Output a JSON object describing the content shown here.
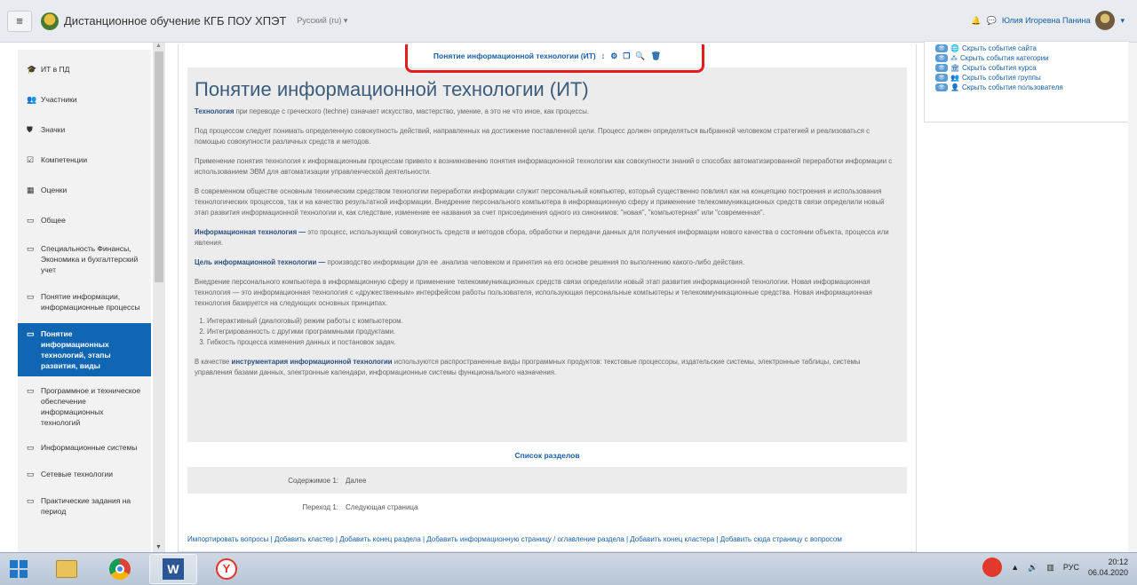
{
  "navbar": {
    "site_name": "Дистанционное обучение КГБ ПОУ ХПЭТ",
    "language": "Русский (ru) ▾",
    "user_name": "Юлия Игоревна Панина"
  },
  "sidebar": {
    "items": [
      {
        "icon": "mortarboard-icon",
        "label": "ИТ в ПД"
      },
      {
        "icon": "users-icon",
        "label": "Участники"
      },
      {
        "icon": "shield-icon",
        "label": "Значки"
      },
      {
        "icon": "checkbox-icon",
        "label": "Компетенции"
      },
      {
        "icon": "table-icon",
        "label": "Оценки"
      },
      {
        "icon": "folder-icon",
        "label": "Общее"
      },
      {
        "icon": "folder-icon",
        "label": "Специальность Финансы, Экономика и бухгалтерский учет"
      },
      {
        "icon": "folder-icon",
        "label": "Понятие информации, информационные процессы"
      },
      {
        "icon": "folder-icon",
        "label": "Понятие информационных технологий, этапы развития, виды"
      },
      {
        "icon": "folder-icon",
        "label": "Программное и техническое обеспечение информационных технологий"
      },
      {
        "icon": "folder-icon",
        "label": "Информационные системы"
      },
      {
        "icon": "folder-icon",
        "label": "Сетевые технологии"
      },
      {
        "icon": "folder-icon",
        "label": "Практические задания на период"
      }
    ]
  },
  "lesson": {
    "header_title": "Понятие информационной технологии (ИТ)",
    "page_title": "Понятие информационной технологии (ИТ)",
    "p1_bold": "Технология",
    "p1_rest": " при переводе с греческого (techne) означает искусство, мастерство, умение, а это не что иное, как процессы.",
    "p2": "Под процессом следует понимать определенную совокупность действий, направленных на достижение поставленной цели. Процесс должен определяться выбранной человеком стратегией и реализоваться с помощью совокупности различных средств и методов.",
    "p3": "Применение понятия технология к информационным процессам привело к возникновению понятия информационной технологии как совокупности знаний о способах автоматизированной переработки информации с использованием ЭВМ для автоматизации управленческой деятельности.",
    "p4": "В современном обществе основным техническим средством технологии переработки информации служит персональный компьютер, который существенно повлиял как на концепцию построения и использования технологических процессов, так и на качество результатной информации. Внедрение персонального компьютера в информационную сферу и применение телекоммуникационных средств связи определили новый этап развития информационной технологии и, как следствие, изменение ее названия за счет присоединения одного из синонимов: \"новая\", \"компьютерная\" или \"современная\".",
    "p5_bold": "Информационная технология —",
    "p5_rest": " это процесс, использующий совокупность средств и методов сбора, обработки и передачи данных для получения информации нового качества о состоянии объекта, процесса или явления.",
    "p6_bold": "Цель информационной технологии —",
    "p6_rest": " производство информации для ее .анализа человеком и принятия на его основе решения по выполнению какого-либо действия.",
    "p7": "Внедрение персонального компьютера в информационную сферу и применение телекоммуникационных средств связи определили новый этап развития информационной технологии. Новая информационная технология — это информационная технология с «дружественным» интерфейсом работы пользователя, использующая персональные компьютеры и телекоммуникационные средства. Новая информационная технология базируется на следующих основных принципах.",
    "list": [
      "Интерактивный (диалоговый) режим работы с компьютером.",
      "Интегрированность с другими программными продуктами.",
      "Гибкость процесса изменения данных и постановок задач."
    ],
    "p8_a": "В качестве ",
    "p8_bold": "инструментария информационной технологии",
    "p8_rest": " используются распространенные виды программных продуктов: текстовые процессоры, издательские системы, электронные таблицы, системы управления базами данных, электронные календари, информационные системы функционального назначения.",
    "sections_title": "Список разделов",
    "content_label": "Содержимое 1:",
    "content_value": "Далее",
    "jump_label": "Переход 1:",
    "jump_value": "Следующая страница",
    "actions": "Импортировать вопросы | Добавить кластер | Добавить конец раздела | Добавить информационную страницу / оглавление раздела | Добавить конец кластера | Добавить сюда страницу с вопросом"
  },
  "events": {
    "items": [
      {
        "icon": "globe-icon",
        "label": "Скрыть события сайта"
      },
      {
        "icon": "category-icon",
        "label": "Скрыть события категории"
      },
      {
        "icon": "course-icon",
        "label": "Скрыть события курса"
      },
      {
        "icon": "group-icon",
        "label": "Скрыть события группы"
      },
      {
        "icon": "user-icon",
        "label": "Скрыть события пользователя"
      }
    ]
  },
  "taskbar": {
    "lang": "РУС",
    "time": "20:12",
    "date": "06.04.2020"
  },
  "colors": {
    "accent": "#1166b4",
    "highlight": "#e61b1b",
    "navbar": "#e8ecf0"
  }
}
